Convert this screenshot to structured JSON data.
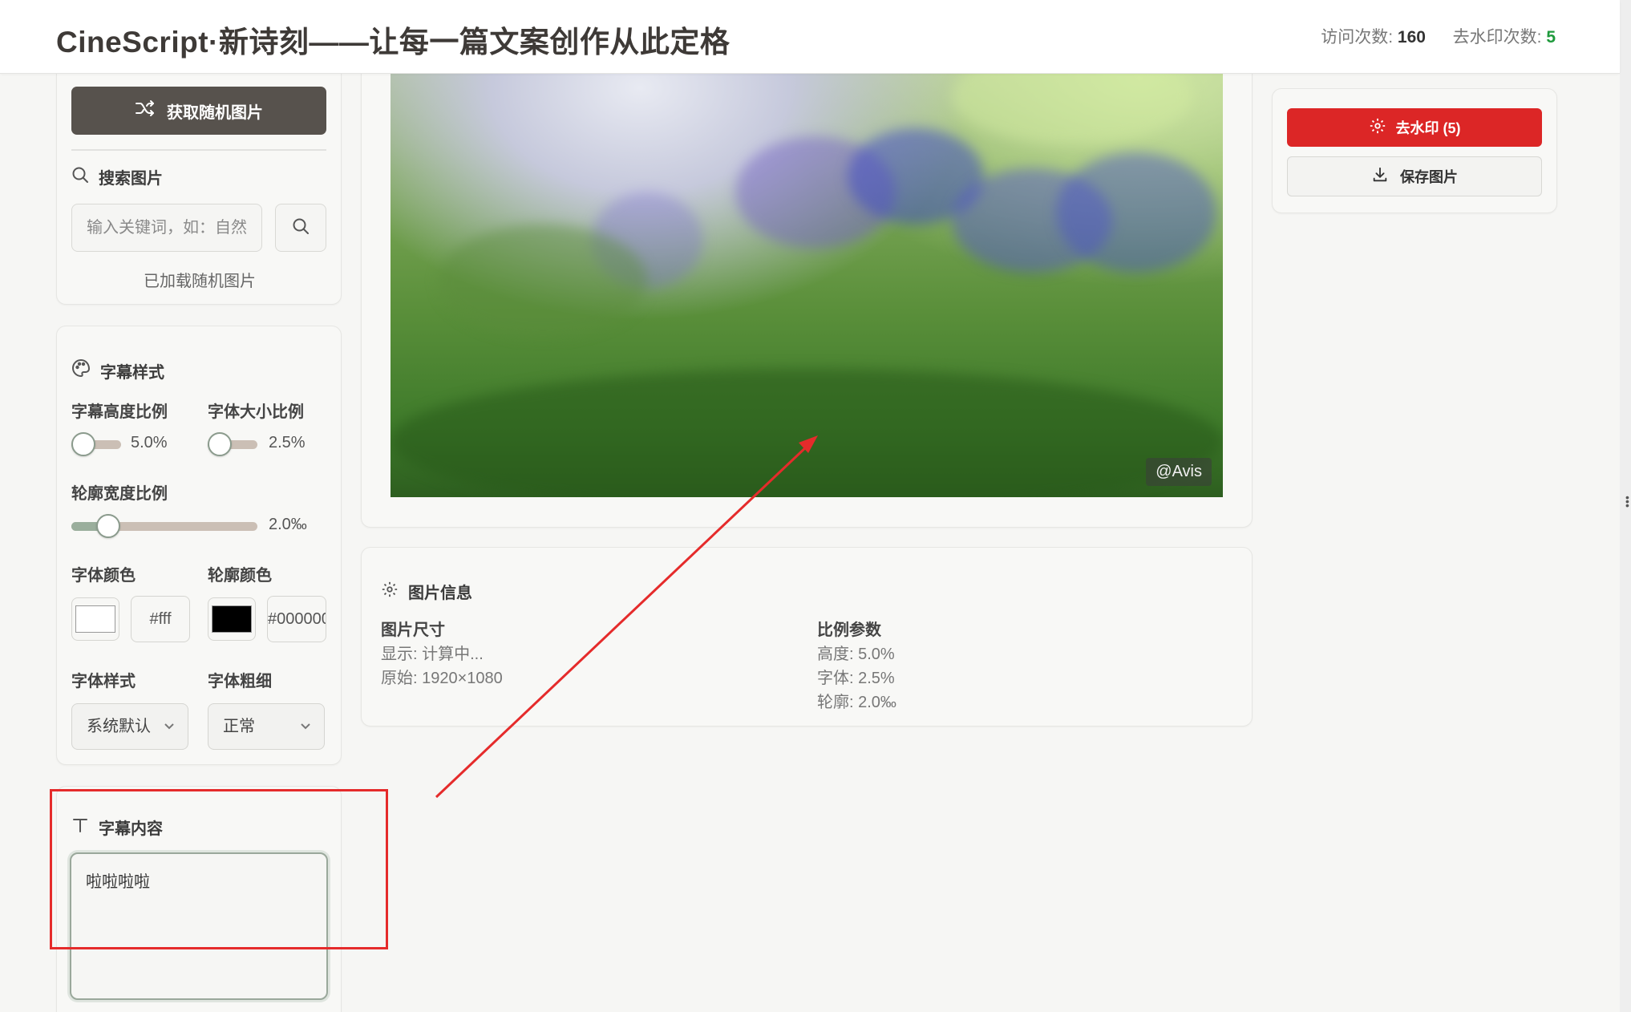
{
  "header": {
    "title": "CineScript·新诗刻——让每一篇文案创作从此定格",
    "visits_label": "访问次数:",
    "visits_value": "160",
    "remove_count_label": "去水印次数:",
    "remove_count_value": "5"
  },
  "search": {
    "random_button_label": "获取随机图片",
    "heading": "搜索图片",
    "input_placeholder": "输入关键词，如：自然",
    "status_text": "已加载随机图片"
  },
  "subtitle_style": {
    "heading": "字幕样式",
    "height_ratio_label": "字幕高度比例",
    "height_ratio_value": "5.0%",
    "height_ratio_level": 0.18,
    "font_size_ratio_label": "字体大小比例",
    "font_size_ratio_value": "2.5%",
    "font_size_ratio_level": 0.2,
    "outline_width_label": "轮廓宽度比例",
    "outline_width_value": "2.0‰",
    "outline_width_level": 0.2,
    "font_color_label": "字体颜色",
    "font_color_hex": "#fff",
    "font_color_swatch": "#ffffff",
    "outline_color_label": "轮廓颜色",
    "outline_color_hex": "#000000",
    "outline_color_swatch": "#000000",
    "font_style_label": "字体样式",
    "font_style_value": "系统默认",
    "font_weight_label": "字体粗细",
    "font_weight_value": "正常"
  },
  "caption": {
    "heading": "字幕内容",
    "text": "啦啦啦啦"
  },
  "preview": {
    "watermark": "@Avis"
  },
  "image_info": {
    "heading": "图片信息",
    "size_title": "图片尺寸",
    "display_line": "显示: 计算中...",
    "original_line": "原始: 1920×1080",
    "ratio_title": "比例参数",
    "height_line": "高度: 5.0%",
    "font_line": "字体: 2.5%",
    "outline_line": "轮廓: 2.0‰"
  },
  "actions": {
    "remove_watermark_label": "去水印 (5)",
    "save_label": "保存图片"
  },
  "colors": {
    "primary_dark": "#57524d",
    "danger": "#dc2626",
    "annotation": "#e52b2b",
    "success": "#1f9a3c"
  },
  "icons": [
    "shuffle-icon",
    "search-icon",
    "palette-icon",
    "text-icon",
    "gear-icon",
    "download-icon",
    "chevron-down-icon"
  ]
}
